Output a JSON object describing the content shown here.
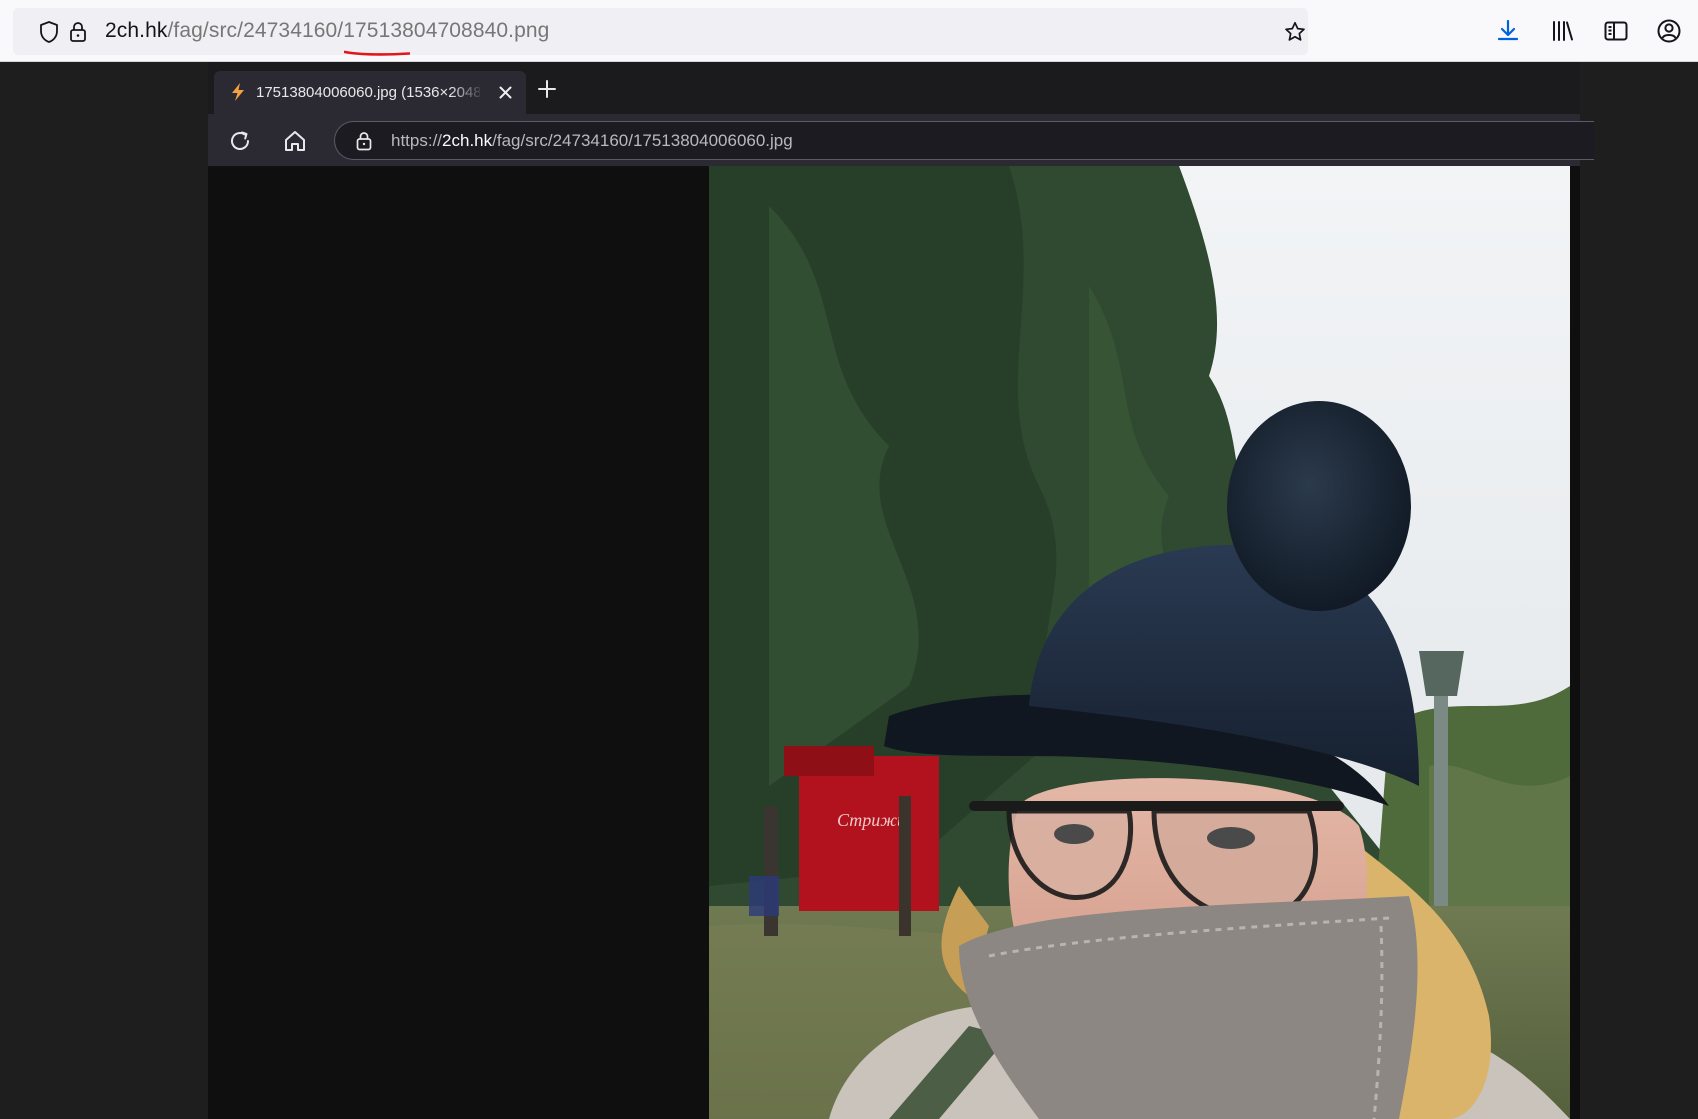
{
  "outer_browser": {
    "url": {
      "host": "2ch.hk",
      "path": "/fag/src/24734160/17513804708840.png"
    },
    "icons": {
      "shield": "shield-icon",
      "lock": "lock-icon",
      "star": "star-icon",
      "download": "download-icon",
      "library": "library-icon",
      "sidebar": "sidebar-icon",
      "account": "account-icon"
    },
    "accent": "#0061e0",
    "annotation_color": "#e5141b"
  },
  "inner_browser": {
    "tab": {
      "title": "17513804006060.jpg (1536×2048"
    },
    "url": {
      "scheme": "https://",
      "host": "2ch.hk",
      "path": "/fag/src/24734160/17513804006060.jpg"
    },
    "icons": {
      "tab_favicon": "bolt-icon",
      "tab_close": "close-icon",
      "new_tab": "plus-icon",
      "reload": "reload-icon",
      "home": "home-icon",
      "lock": "lock-icon"
    }
  },
  "image": {
    "subject": "photo"
  }
}
